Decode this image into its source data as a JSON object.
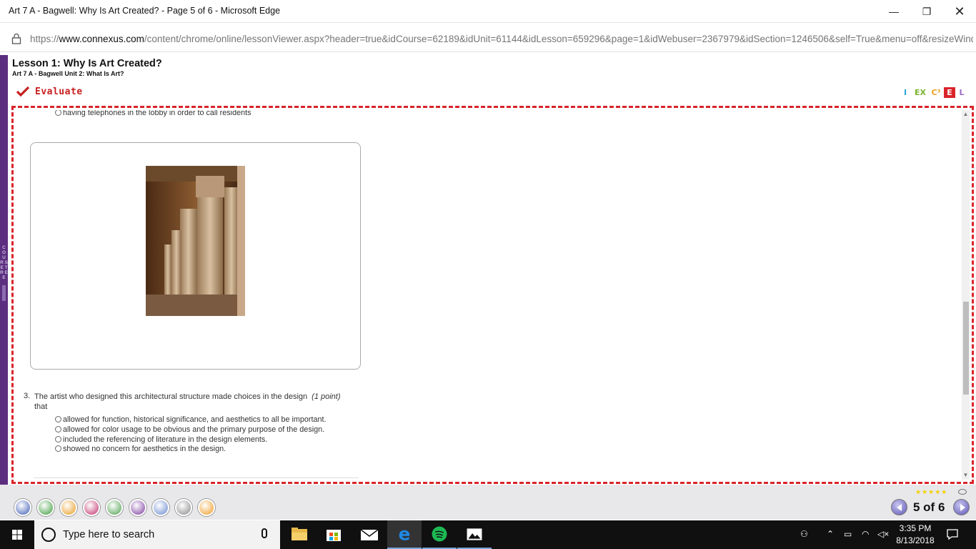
{
  "window": {
    "title": "Art 7 A - Bagwell: Why Is Art Created? - Page 5 of 6 - Microsoft Edge",
    "minimize_glyph": "—",
    "maximize_glyph": "❐",
    "close_glyph": "✕"
  },
  "address": {
    "prefix": "https://",
    "domain": "www.connexus.com",
    "path": "/content/chrome/online/lessonViewer.aspx?header=true&idCourse=62189&idUnit=61144&idLesson=659296&page=1&idWebuser=2367979&idSection=1246506&self=True&menu=off&resizeWindow="
  },
  "sidebar": {
    "course_tree_label": "C O U R S E T R E E"
  },
  "lesson": {
    "title": "Lesson 1: Why Is Art Created?",
    "subtitle": "Art 7 A - Bagwell  Unit 2: What Is Art?"
  },
  "phase": {
    "label": "Evaluate"
  },
  "badges": [
    {
      "text": "I",
      "color": "#2aa7d8",
      "bg": "transparent"
    },
    {
      "text": "EX",
      "color": "#7bb32e",
      "bg": "transparent"
    },
    {
      "text": "C³",
      "color": "#f0a020",
      "bg": "transparent"
    },
    {
      "text": "E",
      "color": "#ffffff",
      "bg": "#d9242a"
    },
    {
      "text": "L",
      "color": "#9b6cc2",
      "bg": "transparent"
    }
  ],
  "prev_question": {
    "last_option": "having telephones in the lobby in order to call residents"
  },
  "question": {
    "number": "3.",
    "text": "The artist who designed this architectural structure made choices in the design",
    "points": "(1 point)",
    "text_cont": "that",
    "options": [
      "allowed for function, historical significance, and aesthetics to all be important.",
      "allowed for color usage to be obvious and the primary purpose of the design.",
      "included the referencing of literature in the design elements.",
      "showed no concern for aesthetics in the design."
    ]
  },
  "toolbar": {
    "tools": [
      {
        "icon": "checkmark-icon",
        "color": "#3b5bb5"
      },
      {
        "icon": "globe-icon",
        "color": "#3a9a3a"
      },
      {
        "icon": "gift-icon",
        "color": "#e89a1c"
      },
      {
        "icon": "pencil-icon",
        "color": "#c2306a"
      },
      {
        "icon": "calculator-icon",
        "color": "#4aa04a"
      },
      {
        "icon": "target-icon",
        "color": "#7a3aa0"
      },
      {
        "icon": "notebook-icon",
        "color": "#6a8ad0"
      },
      {
        "icon": "printer-icon",
        "color": "#888888"
      },
      {
        "icon": "help-icon",
        "color": "#f09a20"
      }
    ],
    "stars": "★★★★★",
    "page_indicator": "5 of 6"
  },
  "taskbar": {
    "search_placeholder": "Type here to search",
    "time": "3:35 PM",
    "date": "8/13/2018"
  }
}
